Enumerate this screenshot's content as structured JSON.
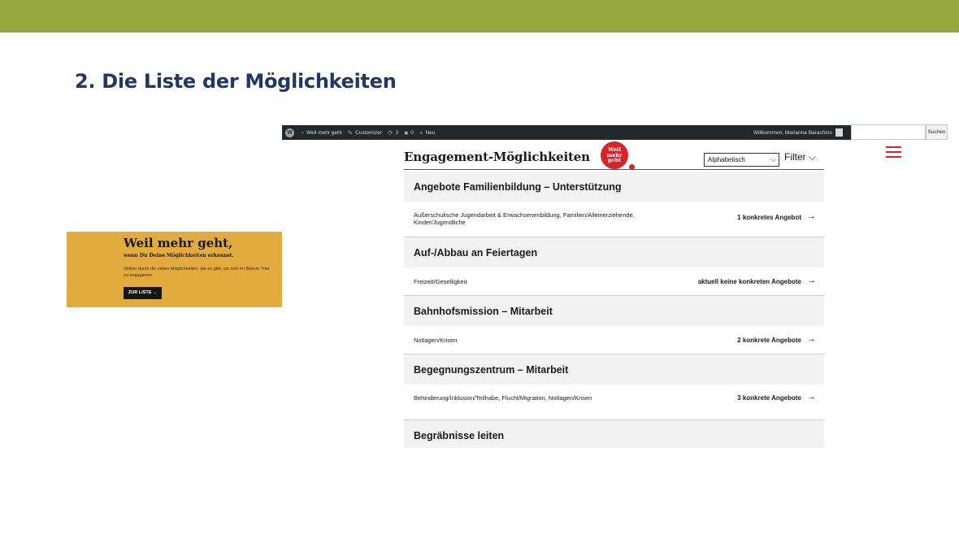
{
  "slide": {
    "title": "2. Die Liste der Möglichkeiten",
    "header_color": "#97a83e",
    "title_color": "#1f3864"
  },
  "promo": {
    "headline": "Weil mehr geht,",
    "subline": "wenn Du Deine Möglichkeiten erkennst.",
    "text": "Stöber durch die vielen Möglichkeiten, die es gibt, um sich im Bistum Trier zu engagieren.",
    "button": "ZUR LISTE →",
    "bg_color": "#e2ab3f"
  },
  "adminbar": {
    "wp_logo_icon": "wordpress-icon",
    "site_icon": "dashboard-icon",
    "site_name": "Weil mehr geht",
    "customizer_icon": "brush-icon",
    "customizer": "Customizer",
    "updates_icon": "refresh-icon",
    "updates_count": "2",
    "comments_icon": "comment-icon",
    "comments_count": "0",
    "new_icon": "plus-icon",
    "new_label": "Neu",
    "welcome": "Willkommen, Marianna Barachino",
    "search_button": "Suchen"
  },
  "page": {
    "title": "Engagement-Möglichkeiten",
    "logo_text": [
      "Weil",
      "mehr",
      "geht"
    ],
    "sort_value": "Alphabetisch",
    "filter_label": "Filter",
    "menu_icon": "hamburger-menu-icon",
    "accent_color": "#d8232a"
  },
  "list": [
    {
      "category": "Angebote Familienbildung – Unterstützung",
      "tags": "Außerschulische Jugendarbeit & Erwachsenenbildung, Familien/Alleinerziehende, Kinder/Jugendliche",
      "count": "1 konkretes Angebot"
    },
    {
      "category": "Auf-/Abbau an Feiertagen",
      "tags": "Freizeit/Geselligkeit",
      "count": "aktuell keine konkreten Angebote"
    },
    {
      "category": "Bahnhofsmission – Mitarbeit",
      "tags": "Notlagen/Krisen",
      "count": "2 konkrete Angebote"
    },
    {
      "category": "Begegnungszentrum – Mitarbeit",
      "tags": "Behinderung/Inklusion/Teilhabe, Flucht/Migration, Notlagen/Krisen",
      "count": "3 konkrete Angebote"
    },
    {
      "category": "Begräbnisse leiten"
    }
  ]
}
